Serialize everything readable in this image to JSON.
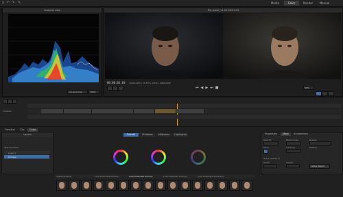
{
  "workspaces": [
    "Media",
    "Color",
    "Render",
    "Manual"
  ],
  "scope": {
    "title": "Analysis view",
    "mode": "Curves Luma",
    "zoom": "100%"
  },
  "viewer": {
    "title": "Rip grade_v1 01:00:01:03",
    "timecode": "00:00:01:03",
    "info": "1920x1080 | 25 FPS | 120/0 | 1080/1080",
    "zoom": "50%"
  },
  "timeline": {
    "track_label": "Timeline"
  },
  "bottom_tabs": [
    "Timeline",
    "Clip",
    "Color"
  ],
  "layers": {
    "title": "Layers",
    "header": "Mode & Notes",
    "items": [
      "Layer 1",
      "Primary"
    ]
  },
  "color_tabs": [
    "Overall",
    "Shadows",
    "Midtones",
    "Highlights"
  ],
  "look_files": [
    "digital grading",
    "Look Extended Primary",
    "Look Extended Primary",
    "Look Extended Primary",
    "Look Extended Secondary"
  ],
  "thumb_labels": [
    "Kodak 2383",
    "Fuji 3513DI",
    "Fuji F-125",
    "Kodak 5218",
    "Fuji Eterna",
    "Kodak 2393",
    "Fuji Reala",
    "Kodak 5207",
    "Fuji F-400",
    "Kodak 5219",
    "Fuji F-64",
    "Kodak 5229",
    "Fuji Velvia",
    "Kodak 5285",
    "Fuji F-250",
    "Kodak 5205"
  ],
  "right_tabs": [
    "Properties",
    "Mask",
    "Annotations"
  ],
  "right_labels": {
    "opacity": "Opacity",
    "blend": "Blend mode",
    "bypass": "Bypass",
    "track": "Track",
    "tracking": "Tracking",
    "feather": "Feather",
    "scale": "Scale relative to",
    "width": "Width",
    "height": "Height",
    "show_button": "Show Object"
  },
  "colors": {
    "accent": "#3c6ea8"
  }
}
